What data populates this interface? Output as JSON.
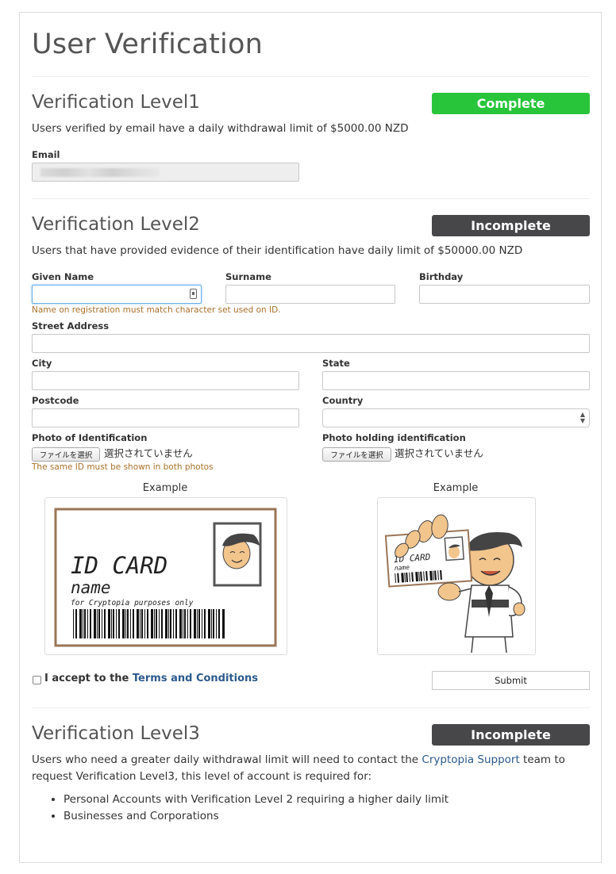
{
  "page": {
    "title": "User Verification"
  },
  "level1": {
    "title": "Verification Level1",
    "status": "Complete",
    "description": "Users verified by email have a daily withdrawal limit of $5000.00 NZD",
    "email_label": "Email"
  },
  "level2": {
    "title": "Verification Level2",
    "status": "Incomplete",
    "description": "Users that have provided evidence of their identification have daily limit of $50000.00 NZD",
    "given_name_label": "Given Name",
    "surname_label": "Surname",
    "birthday_label": "Birthday",
    "name_help": "Name on registration must match character set used on ID.",
    "street_label": "Street Address",
    "city_label": "City",
    "state_label": "State",
    "postcode_label": "Postcode",
    "country_label": "Country",
    "photo_id_label": "Photo of Identification",
    "photo_holding_label": "Photo holding identification",
    "file_button": "ファイルを選択",
    "file_status": "選択されていません",
    "photo_help": "The same ID must be shown in both photos",
    "example_label": "Example",
    "id_card_text": "ID CARD",
    "id_name_text": "name",
    "id_purpose_text": "for Cryptopia purposes only",
    "accept_prefix": "I accept to the ",
    "terms_link": "Terms and Conditions",
    "submit_label": "Submit"
  },
  "level3": {
    "title": "Verification Level3",
    "status": "Incomplete",
    "desc_prefix": "Users who need a greater daily withdrawal limit will need to contact the ",
    "support_link": "Cryptopia Support",
    "desc_suffix": " team to request Verification Level3, this level of account is required for:",
    "bullets": [
      "Personal Accounts with Verification Level 2 requiring a higher daily limit",
      "Businesses and Corporations"
    ]
  },
  "colors": {
    "complete": "#28c53a",
    "incomplete": "#47474a",
    "link": "#2b5a8c",
    "help_text": "#a8702b"
  }
}
